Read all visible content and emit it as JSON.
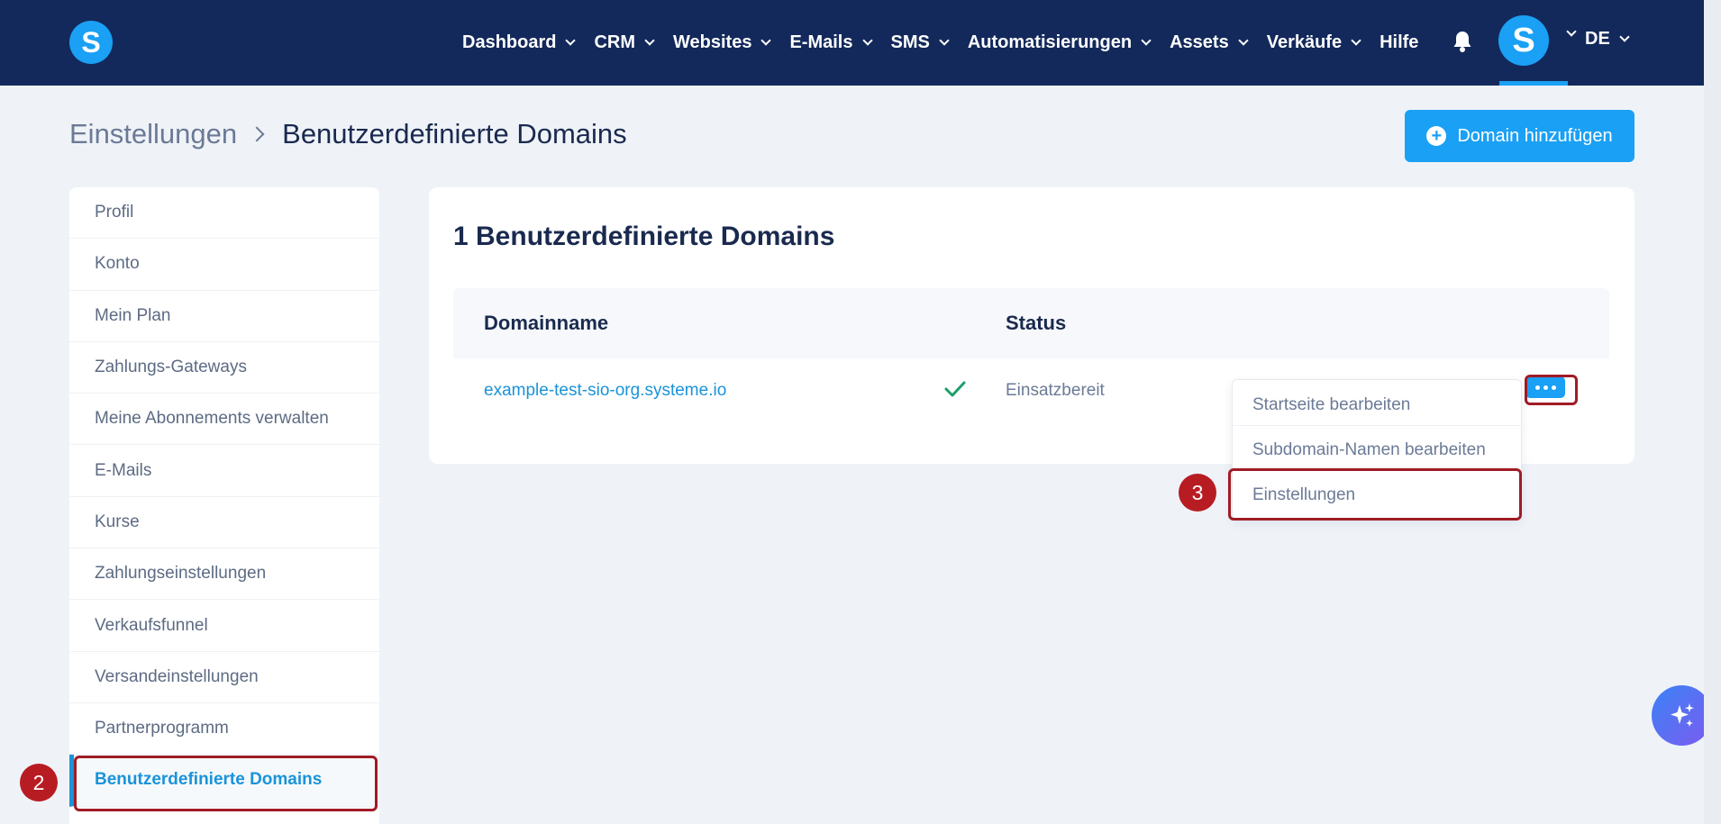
{
  "brand": {
    "logo_letter": "S",
    "avatar_letter": "S",
    "accent": "#1aa0f4",
    "nav_bg": "#13295b"
  },
  "nav": {
    "items": [
      "Dashboard",
      "CRM",
      "Websites",
      "E-Mails",
      "SMS",
      "Automatisierungen",
      "Assets",
      "Verkäufe"
    ],
    "help": "Hilfe",
    "language": "DE",
    "notification_icon": "bell-icon"
  },
  "breadcrumb": {
    "parent": "Einstellungen",
    "current": "Benutzerdefinierte Domains"
  },
  "add_domain_button": "Domain hinzufügen",
  "sidebar": {
    "items": [
      "Profil",
      "Konto",
      "Mein Plan",
      "Zahlungs-Gateways",
      "Meine Abonnements verwalten",
      "E-Mails",
      "Kurse",
      "Zahlungseinstellungen",
      "Verkaufsfunnel",
      "Versandeinstellungen",
      "Partnerprogramm",
      "Benutzerdefinierte Domains"
    ],
    "active": "Benutzerdefinierte Domains"
  },
  "main": {
    "title": "1 Benutzerdefinierte Domains",
    "columns": [
      "Domainname",
      "Status"
    ],
    "rows": [
      {
        "domain": "example-test-sio-org.systeme.io",
        "status": "Einsatzbereit",
        "status_icon": "check-icon"
      }
    ],
    "actions_menu": [
      "Startseite bearbeiten",
      "Subdomain-Namen bearbeiten",
      "Einstellungen"
    ]
  },
  "annotations": {
    "step_sidebar": "2",
    "step_menu": "3",
    "highlight_color": "#a01c25"
  }
}
